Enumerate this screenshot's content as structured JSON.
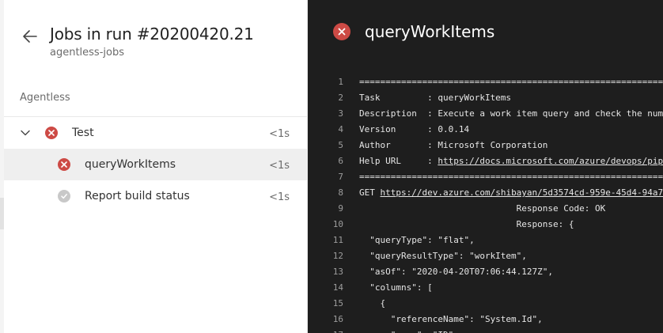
{
  "header": {
    "title": "Jobs in run #20200420.21",
    "subtitle": "agentless-jobs"
  },
  "section": {
    "label": "Agentless"
  },
  "jobs": [
    {
      "name": "Test",
      "time": "<1s",
      "status": "failed"
    },
    {
      "name": "queryWorkItems",
      "time": "<1s",
      "status": "failed",
      "selected": true
    },
    {
      "name": "Report build status",
      "time": "<1s",
      "status": "success"
    }
  ],
  "log": {
    "title": "queryWorkItems",
    "lines": [
      {
        "n": "1",
        "pre": "=================================================================================",
        "link": "",
        "post": ""
      },
      {
        "n": "2",
        "pre": "Task         : queryWorkItems",
        "link": "",
        "post": ""
      },
      {
        "n": "3",
        "pre": "Description  : Execute a work item query and check the number",
        "link": "",
        "post": ""
      },
      {
        "n": "4",
        "pre": "Version      : 0.0.14",
        "link": "",
        "post": ""
      },
      {
        "n": "5",
        "pre": "Author       : Microsoft Corporation",
        "link": "",
        "post": ""
      },
      {
        "n": "6",
        "pre": "Help URL     : ",
        "link": "https://docs.microsoft.com/azure/devops/pipelines",
        "post": ""
      },
      {
        "n": "7",
        "pre": "=================================================================================",
        "link": "",
        "post": ""
      },
      {
        "n": "8",
        "pre": "GET ",
        "link": "https://dev.azure.com/shibayan/5d3574cd-959e-45d4-94a7",
        "post": ""
      },
      {
        "n": "9",
        "pre": "                              Response Code: OK",
        "link": "",
        "post": ""
      },
      {
        "n": "10",
        "pre": "                              Response: {",
        "link": "",
        "post": ""
      },
      {
        "n": "11",
        "pre": "  \"queryType\": \"flat\",",
        "link": "",
        "post": ""
      },
      {
        "n": "12",
        "pre": "  \"queryResultType\": \"workItem\",",
        "link": "",
        "post": ""
      },
      {
        "n": "13",
        "pre": "  \"asOf\": \"2020-04-20T07:06:44.127Z\",",
        "link": "",
        "post": ""
      },
      {
        "n": "14",
        "pre": "  \"columns\": [",
        "link": "",
        "post": ""
      },
      {
        "n": "15",
        "pre": "    {",
        "link": "",
        "post": ""
      },
      {
        "n": "16",
        "pre": "      \"referenceName\": \"System.Id\",",
        "link": "",
        "post": ""
      },
      {
        "n": "17",
        "pre": "      \"name\": \"ID\",",
        "link": "",
        "post": ""
      }
    ]
  },
  "colors": {
    "failed": "#cd4a45",
    "success": "#c8c8c8",
    "log_background": "#1e1e1e",
    "selected_row": "#efefef"
  }
}
